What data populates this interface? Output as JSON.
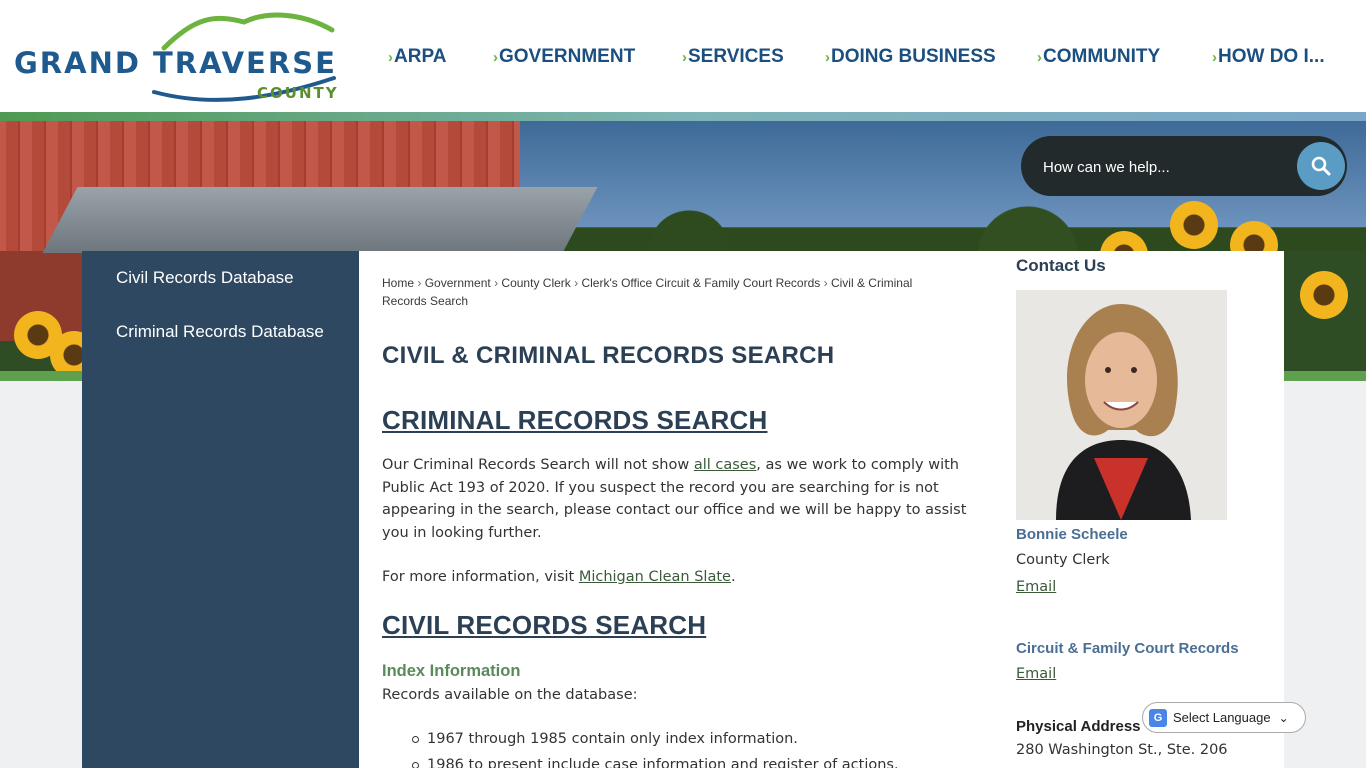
{
  "logo": {
    "line1": "GRAND TRAVERSE",
    "line2": "COUNTY"
  },
  "nav": [
    {
      "label": "ARPA"
    },
    {
      "label": "GOVERNMENT"
    },
    {
      "label": "SERVICES"
    },
    {
      "label": "DOING BUSINESS"
    },
    {
      "label": "COMMUNITY"
    },
    {
      "label": "HOW DO I..."
    }
  ],
  "search": {
    "placeholder": "How can we help..."
  },
  "sidebar": {
    "items": [
      {
        "label": "Civil Records Database"
      },
      {
        "label": "Criminal Records Database"
      }
    ]
  },
  "breadcrumb": {
    "items": [
      "Home",
      "Government",
      "County Clerk",
      "Clerk's Office Circuit & Family Court Records",
      "Civil & Criminal Records Search"
    ],
    "separator": "›"
  },
  "main": {
    "title": "CIVIL & CRIMINAL RECORDS SEARCH",
    "criminal_heading": "CRIMINAL RECORDS SEARCH",
    "criminal_para_before": "Our Criminal Records Search will not show ",
    "criminal_para_link": "all cases",
    "criminal_para_after": ", as we work to comply with Public Act 193 of 2020. If you suspect the record you are searching for is not appearing in the search, please contact our office and we will be happy to assist you in looking further.",
    "info_before": "For more information, visit ",
    "info_link": "Michigan Clean Slate",
    "info_after": ".",
    "civil_heading": "CIVIL RECORDS SEARCH",
    "index_heading": "Index Information",
    "records_available": "Records available on the database:",
    "records_list": [
      "1967 through 1985 contain only index information.",
      "1986 to present include case information and register of actions."
    ]
  },
  "contact": {
    "title": "Contact Us",
    "person_name": "Bonnie Scheele",
    "person_title": "County Clerk",
    "email1": "Email",
    "dept_name": "Circuit & Family Court Records",
    "email2": "Email",
    "address_label": "Physical Address",
    "address_line1": "280 Washington St., Ste. 206"
  },
  "translate": {
    "label": "Select Language",
    "icon": "google-translate-icon"
  },
  "colors": {
    "navy": "#2e4862",
    "nav_text": "#1b4f80",
    "accent_green": "#6db33f",
    "search_btn": "#5b9cc4"
  }
}
